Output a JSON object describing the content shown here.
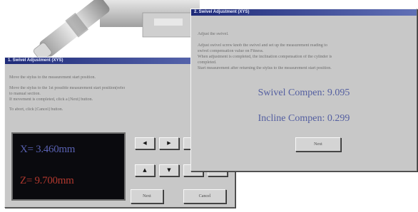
{
  "back_window": {
    "title": "1. Swivel Adjustment (XYS)",
    "instructions": [
      "Move the stylus to the measurement start position.",
      "Move the stylus to the 1st possible measurement start position(refer",
      "to manual section.",
      "If movement is completed, click a [Next] button.",
      "To abort, click [Cancel] button."
    ],
    "readout_x": "X= 3.460mm",
    "readout_z": "Z= 9.700mm",
    "jog_buttons": [
      "◀",
      "▶",
      "◀",
      "▲",
      "▼",
      "⇕",
      "⇕"
    ],
    "next_label": "Next",
    "cancel_label": "Cancel"
  },
  "front_window": {
    "title": "2. Swivel Adjustment (XYS)",
    "heading": "Adjust the swivel.",
    "instructions": [
      "Adjust swivel screw knob the swivel and set up the measurement reading to",
      "swivel compensation value on Fitness.",
      "When adjustment is completed, the inclination compensation of the cylinder is",
      "completed.",
      "Start measurement after returning the stylus to the measurement start position."
    ],
    "swivel_compen": "Swivel Compen: 9.095",
    "incline_compen": "Incline Compen: 0.299",
    "ok_label": "Next"
  }
}
